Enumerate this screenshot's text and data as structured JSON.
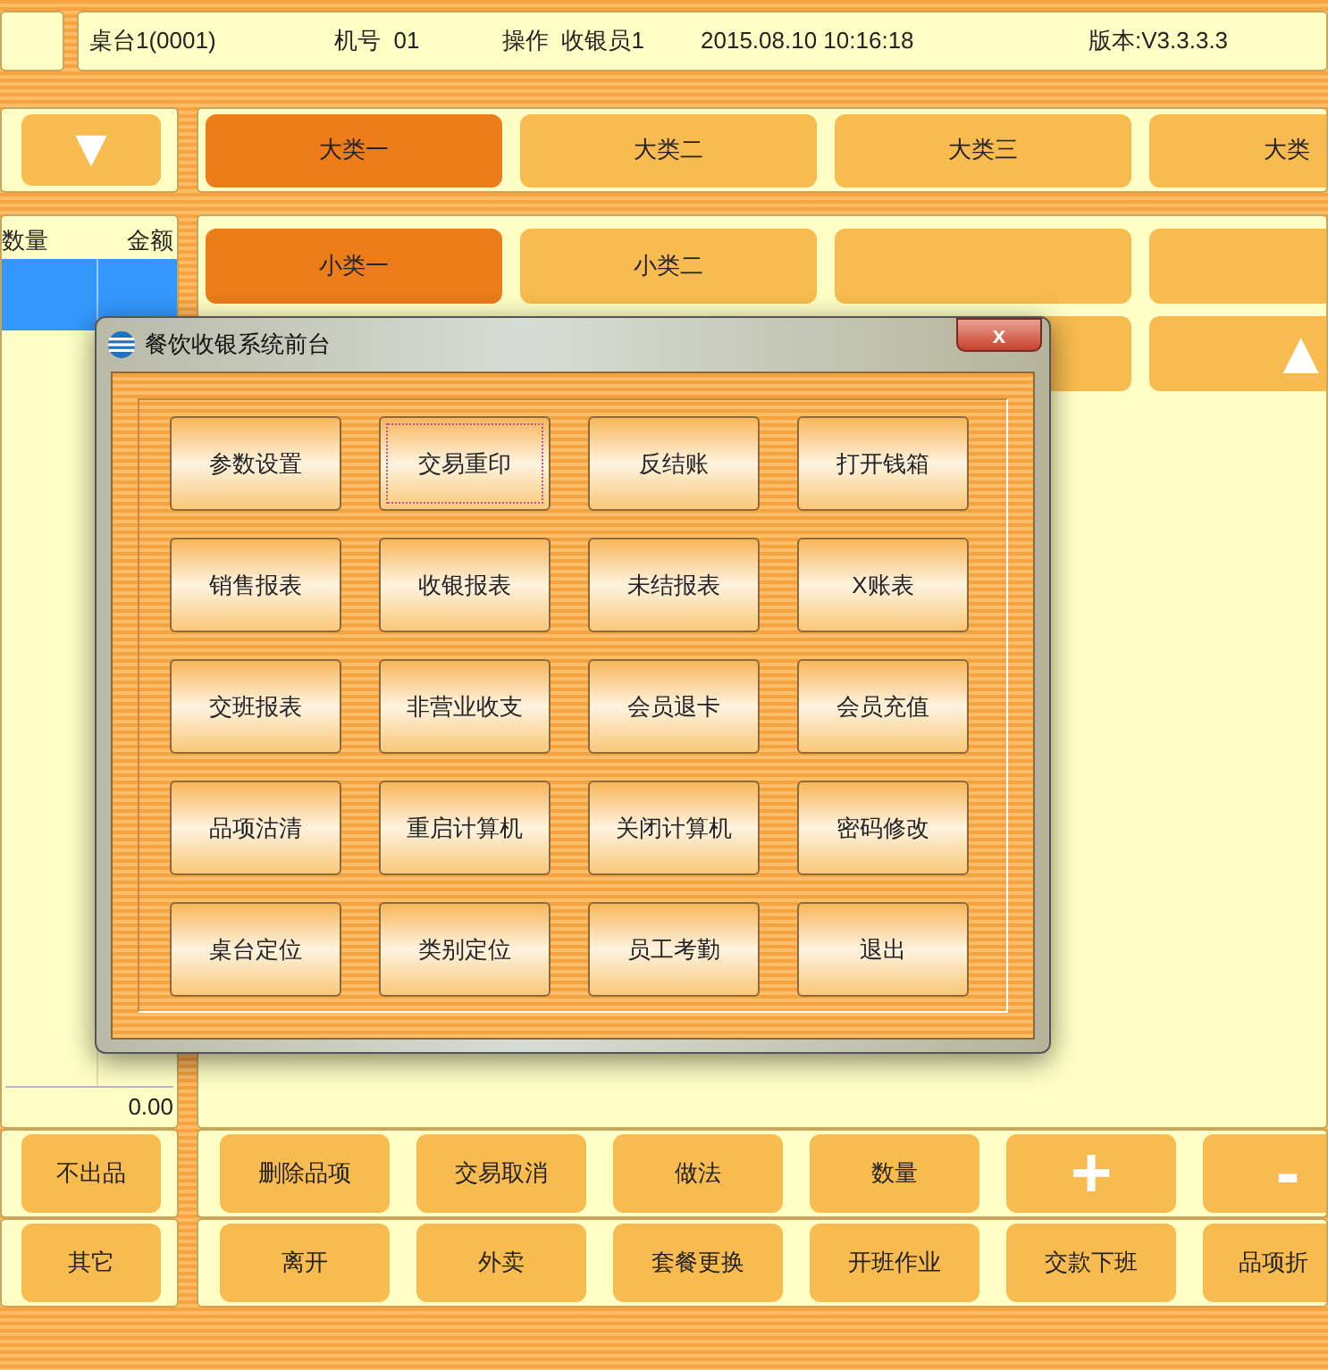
{
  "status_bar": {
    "table": "桌台1(0001)",
    "machine": "机号  01",
    "operator": "操作  收银员1",
    "datetime": "2015.08.10 10:16:18",
    "version": "版本:V3.3.3.3"
  },
  "scroll_down": "▼",
  "categories": [
    {
      "label": "大类一",
      "selected": true
    },
    {
      "label": "大类二",
      "selected": false
    },
    {
      "label": "大类三",
      "selected": false
    },
    {
      "label": "大类",
      "selected": false
    }
  ],
  "subcategories": [
    {
      "label": "小类一",
      "selected": true
    },
    {
      "label": "小类二",
      "selected": false
    },
    {
      "selected": false
    },
    {
      "selected": false
    },
    {
      "selected": false
    }
  ],
  "scroll_up": "▲",
  "order_table": {
    "columns": [
      "数量",
      "金额"
    ],
    "rows": [
      {
        "selected": true
      }
    ],
    "total": "0.00"
  },
  "left_buttons": [
    "不出品",
    "其它"
  ],
  "action_rows": [
    [
      "删除品项",
      "交易取消",
      "做法",
      "数量",
      "+",
      "-"
    ],
    [
      "离开",
      "外卖",
      "套餐更换",
      "开班作业",
      "交款下班",
      "品项折"
    ]
  ],
  "dialog": {
    "title": "餐饮收银系统前台",
    "close": "x",
    "buttons": [
      {
        "label": "参数设置",
        "focused": false
      },
      {
        "label": "交易重印",
        "focused": true
      },
      {
        "label": "反结账",
        "focused": false
      },
      {
        "label": "打开钱箱",
        "focused": false
      },
      {
        "label": "销售报表",
        "focused": false
      },
      {
        "label": "收银报表",
        "focused": false
      },
      {
        "label": "未结报表",
        "focused": false
      },
      {
        "label": "X账表",
        "focused": false
      },
      {
        "label": "交班报表",
        "focused": false
      },
      {
        "label": "非营业收支",
        "focused": false
      },
      {
        "label": "会员退卡",
        "focused": false
      },
      {
        "label": "会员充值",
        "focused": false
      },
      {
        "label": "品项沽清",
        "focused": false
      },
      {
        "label": "重启计算机",
        "focused": false
      },
      {
        "label": "关闭计算机",
        "focused": false
      },
      {
        "label": "密码修改",
        "focused": false
      },
      {
        "label": "桌台定位",
        "focused": false
      },
      {
        "label": "类别定位",
        "focused": false
      },
      {
        "label": "员工考勤",
        "focused": false
      },
      {
        "label": "退出",
        "focused": false
      }
    ]
  }
}
